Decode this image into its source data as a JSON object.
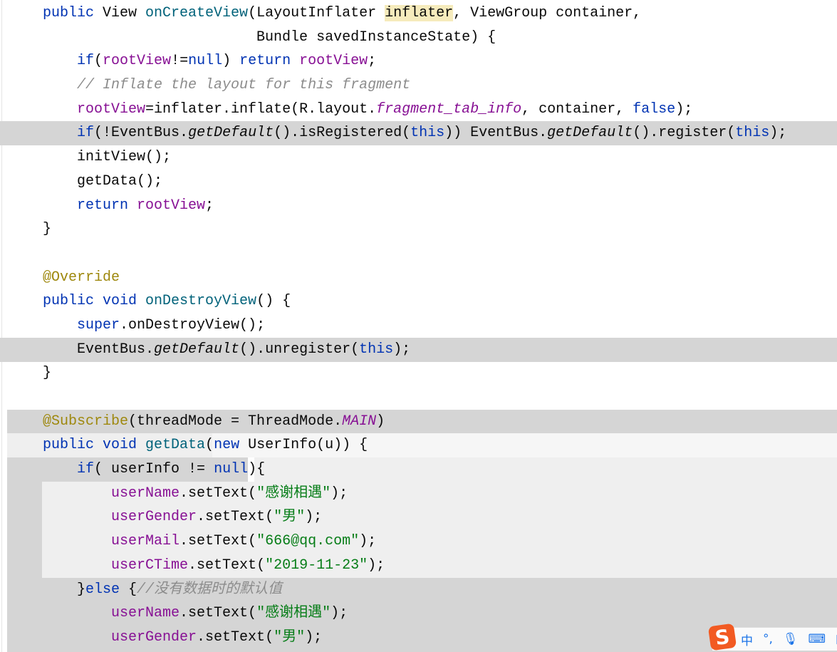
{
  "editor": {
    "lines": [
      [
        [
          "public ",
          "kw"
        ],
        [
          "View ",
          ""
        ],
        [
          "onCreateView",
          "mth"
        ],
        [
          "(LayoutInflater ",
          ""
        ],
        [
          "inflater",
          "mark"
        ],
        [
          ", ViewGroup container,",
          ""
        ]
      ],
      [
        [
          "                         Bundle savedInstanceState) {",
          ""
        ]
      ],
      [
        [
          "    ",
          ""
        ],
        [
          "if",
          "kw"
        ],
        [
          "(",
          ""
        ],
        [
          "rootView",
          "fld"
        ],
        [
          "!=",
          ""
        ],
        [
          "null",
          "kw"
        ],
        [
          ") ",
          ""
        ],
        [
          "return ",
          "kw"
        ],
        [
          "rootView",
          "fld"
        ],
        [
          ";",
          ""
        ]
      ],
      [
        [
          "    ",
          ""
        ],
        [
          "// Inflate the layout for this fragment",
          "cmt"
        ]
      ],
      [
        [
          "    ",
          ""
        ],
        [
          "rootView",
          "fld"
        ],
        [
          "=inflater.inflate(R.layout.",
          ""
        ],
        [
          "fragment_tab_info",
          "itf"
        ],
        [
          ", container, ",
          ""
        ],
        [
          "false",
          "kw"
        ],
        [
          ");",
          ""
        ]
      ],
      [
        [
          "    ",
          ""
        ],
        [
          "if",
          "kw"
        ],
        [
          "(!EventBus.",
          ""
        ],
        [
          "getDefault",
          "it"
        ],
        [
          "().isRegistered(",
          ""
        ],
        [
          "this",
          "kw"
        ],
        [
          ")) EventBus.",
          ""
        ],
        [
          "getDefault",
          "it"
        ],
        [
          "().register(",
          ""
        ],
        [
          "this",
          "kw"
        ],
        [
          ");",
          ""
        ]
      ],
      [
        [
          "    initView();",
          ""
        ]
      ],
      [
        [
          "    getData();",
          ""
        ]
      ],
      [
        [
          "    ",
          ""
        ],
        [
          "return ",
          "kw"
        ],
        [
          "rootView",
          "fld"
        ],
        [
          ";",
          ""
        ]
      ],
      [
        [
          "}",
          ""
        ]
      ],
      [],
      [
        [
          "@Override",
          "ann"
        ]
      ],
      [
        [
          "public void ",
          "kw"
        ],
        [
          "onDestroyView",
          "mth"
        ],
        [
          "() {",
          ""
        ]
      ],
      [
        [
          "    ",
          ""
        ],
        [
          "super",
          "kw"
        ],
        [
          ".onDestroyView();",
          ""
        ]
      ],
      [
        [
          "    EventBus.",
          ""
        ],
        [
          "getDefault",
          "it"
        ],
        [
          "().unregister(",
          ""
        ],
        [
          "this",
          "kw"
        ],
        [
          ");",
          ""
        ]
      ],
      [
        [
          "}",
          ""
        ]
      ],
      [],
      [
        [
          "@Subscribe",
          "ann"
        ],
        [
          "(threadMode = ThreadMode.",
          ""
        ],
        [
          "MAIN",
          "itf"
        ],
        [
          ")",
          ""
        ]
      ],
      [
        [
          "public void ",
          "kw"
        ],
        [
          "getData",
          "mth"
        ],
        [
          "(",
          ""
        ],
        [
          "new ",
          "kw"
        ],
        [
          "UserInfo(u)) {",
          ""
        ]
      ],
      [
        [
          "    ",
          ""
        ],
        [
          "if",
          "kw"
        ],
        [
          "( userInfo != ",
          ""
        ],
        [
          "null",
          "kw"
        ],
        [
          "){",
          ""
        ]
      ],
      [
        [
          "        ",
          ""
        ],
        [
          "userName",
          "fld"
        ],
        [
          ".setText(",
          ""
        ],
        [
          "\"感谢相遇\"",
          "str"
        ],
        [
          ");",
          ""
        ]
      ],
      [
        [
          "        ",
          ""
        ],
        [
          "userGender",
          "fld"
        ],
        [
          ".setText(",
          ""
        ],
        [
          "\"男\"",
          "str"
        ],
        [
          ");",
          ""
        ]
      ],
      [
        [
          "        ",
          ""
        ],
        [
          "userMail",
          "fld"
        ],
        [
          ".setText(",
          ""
        ],
        [
          "\"666@qq.com\"",
          "str"
        ],
        [
          ");",
          ""
        ]
      ],
      [
        [
          "        ",
          ""
        ],
        [
          "userCTime",
          "fld"
        ],
        [
          ".setText(",
          ""
        ],
        [
          "\"2019-11-23\"",
          "str"
        ],
        [
          ");",
          ""
        ]
      ],
      [
        [
          "    }",
          ""
        ],
        [
          "else ",
          "kw"
        ],
        [
          "{",
          ""
        ],
        [
          "//没有数据时的默认值",
          "cmt"
        ]
      ],
      [
        [
          "        ",
          ""
        ],
        [
          "userName",
          "fld"
        ],
        [
          ".setText(",
          ""
        ],
        [
          "\"感谢相遇\"",
          "str"
        ],
        [
          ");",
          ""
        ]
      ],
      [
        [
          "        ",
          ""
        ],
        [
          "userGender",
          "fld"
        ],
        [
          ".setText(",
          ""
        ],
        [
          "\"男\"",
          "str"
        ],
        [
          ");",
          ""
        ]
      ]
    ]
  },
  "ime": {
    "logo": "S",
    "mode": "中",
    "punct": "°,",
    "mic_icon": "microphone-icon",
    "keyboard_icon": "keyboard-icon",
    "shirt_icon": "skin-icon"
  },
  "colors": {
    "keyword": "#0033b3",
    "field": "#871094",
    "method": "#00627a",
    "annotation": "#9e880d",
    "string": "#067d17",
    "comment": "#8c8c8c",
    "highlight": "#d5d5d5"
  }
}
